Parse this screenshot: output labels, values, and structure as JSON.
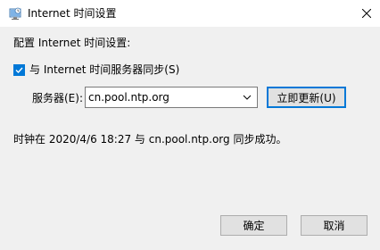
{
  "window": {
    "title": "Internet 时间设置",
    "close_icon": "close-icon"
  },
  "config": {
    "label": "配置 Internet 时间设置:"
  },
  "sync": {
    "checked": true,
    "label": "与 Internet 时间服务器同步(S)"
  },
  "server": {
    "label": "服务器(E):",
    "value": "cn.pool.ntp.org"
  },
  "buttons": {
    "update": "立即更新(U)",
    "ok": "确定",
    "cancel": "取消"
  },
  "status": {
    "text": "时钟在 2020/4/6 18:27 与 cn.pool.ntp.org 同步成功。"
  },
  "colors": {
    "accent": "#0078d7",
    "dialog_bg": "#f0f0f0",
    "button_bg": "#e1e1e1"
  }
}
